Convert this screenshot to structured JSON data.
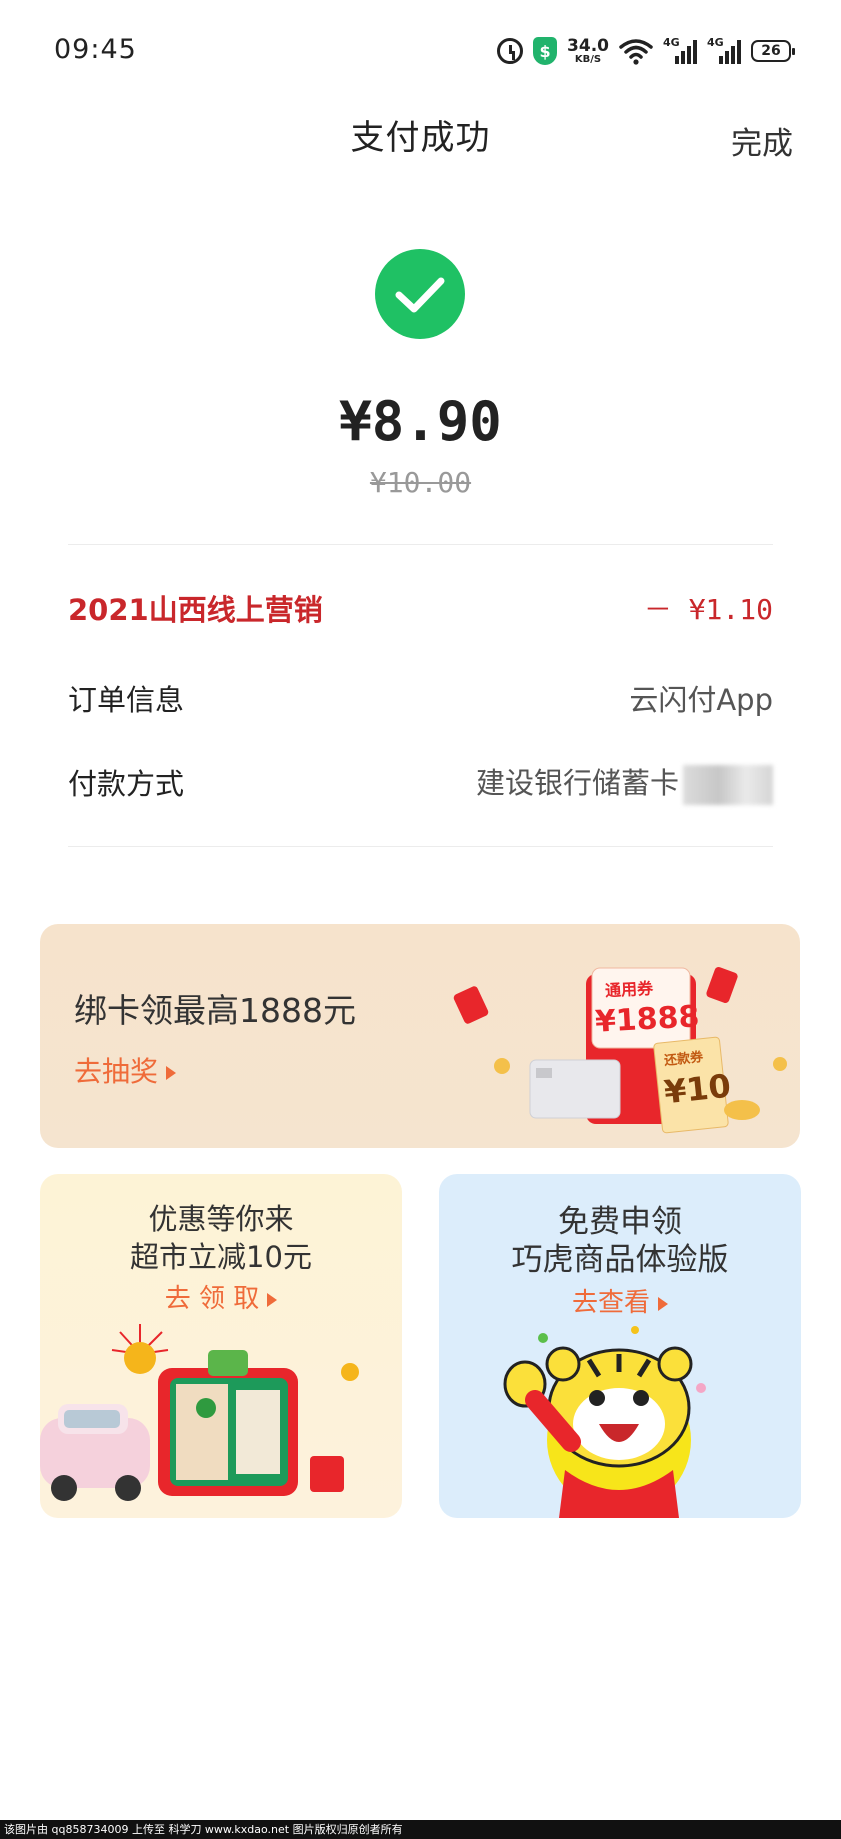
{
  "status_bar": {
    "time": "09:45",
    "net_speed_value": "34.0",
    "net_speed_unit": "KB/S",
    "network_1": "4G",
    "network_2": "4G",
    "battery": "26",
    "icons": [
      "alarm-icon",
      "shield-icon",
      "wifi-icon",
      "signal-icon",
      "signal-icon",
      "battery-icon"
    ]
  },
  "header": {
    "title": "支付成功",
    "done_label": "完成"
  },
  "payment": {
    "amount": "¥8.90",
    "original_amount": "¥10.00",
    "success_icon": "check-circle-icon",
    "success_color": "#1fc164"
  },
  "details": {
    "promo_label": "2021山西线上营销",
    "promo_value": "－ ¥1.10",
    "order_label": "订单信息",
    "order_value": "云闪付App",
    "method_label": "付款方式",
    "method_value": "建设银行储蓄卡",
    "promo_color": "#c9272b"
  },
  "banner": {
    "title": "绑卡领最高1888元",
    "link": "去抽奖",
    "coupon_label": "通用券",
    "coupon_value": "¥1888",
    "voucher_label": "还款券",
    "voucher_value": "¥10"
  },
  "card_left": {
    "line1": "优惠等你来",
    "line2": "超市立减10元",
    "link": "去 领 取"
  },
  "card_right": {
    "line1": "免费申领",
    "line2": "巧虎商品体验版",
    "link": "去查看"
  },
  "watermark": "该图片由 qq858734009 上传至 科学刀 www.kxdao.net 图片版权归原创者所有"
}
